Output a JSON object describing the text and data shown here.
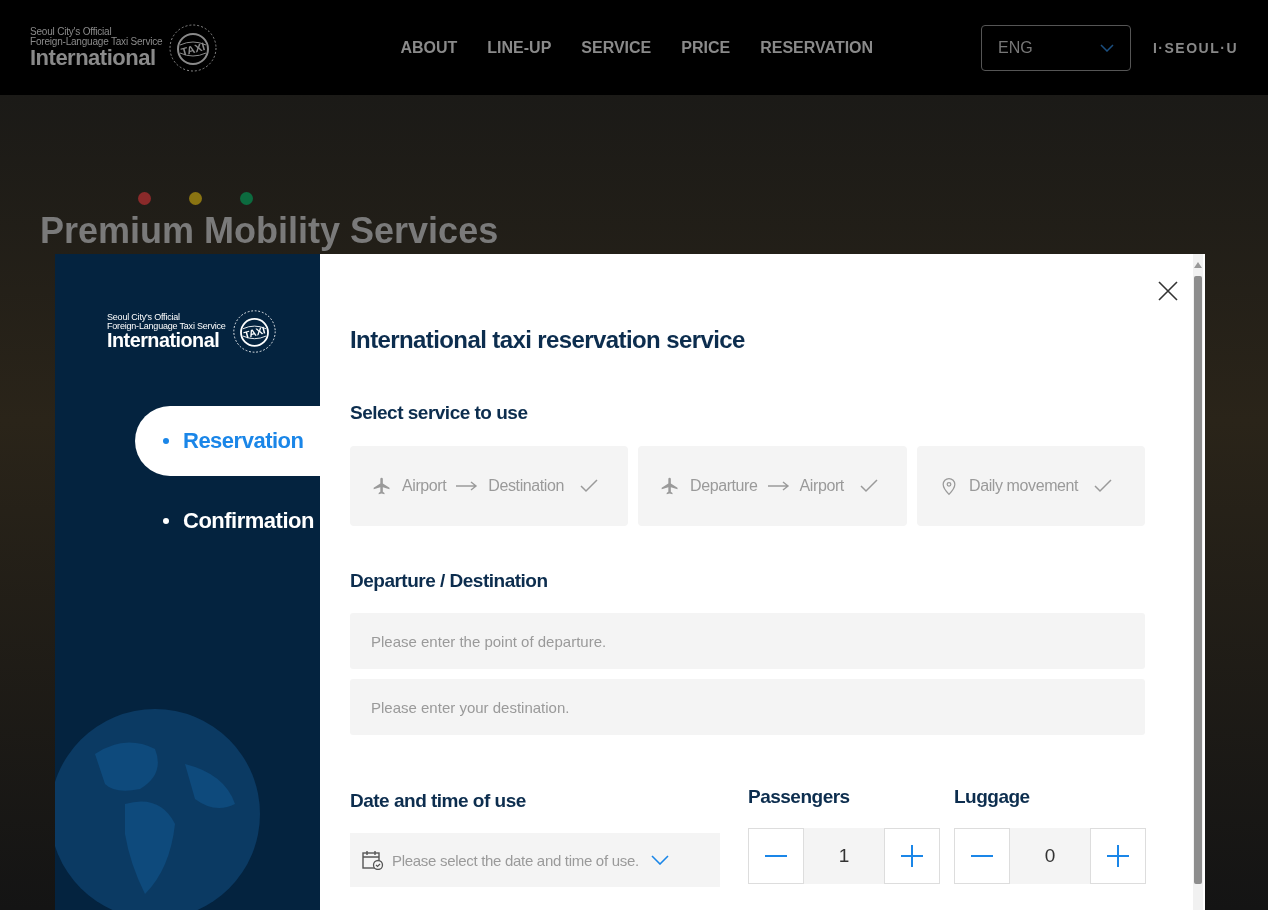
{
  "header": {
    "logo": {
      "line_1": "Seoul City's Official",
      "line_2": "Foreign-Language Taxi Service",
      "name": "International",
      "badge": "TAXI"
    },
    "nav": [
      "ABOUT",
      "LINE-UP",
      "SERVICE",
      "PRICE",
      "RESERVATION"
    ],
    "language": {
      "value": "ENG"
    },
    "brand": "I·SEOUL·U"
  },
  "hero": {
    "dots": [
      {
        "color": "#8a2a2a"
      },
      {
        "color": "#8a7412"
      },
      {
        "color": "#0c6b3f"
      }
    ],
    "lines": [
      "Premium Mobility Services"
    ]
  },
  "modal": {
    "sidebar": {
      "logo": {
        "line_1": "Seoul City's Official",
        "line_2": "Foreign-Language Taxi Service",
        "name": "International",
        "badge": "TAXI"
      },
      "steps": [
        {
          "label": "Reservation",
          "selected": true
        },
        {
          "label": "Confirmation",
          "selected": false
        }
      ]
    },
    "title": "International taxi reservation service",
    "service_heading": "Select service to use",
    "services": [
      {
        "kind": "plane",
        "from": "Airport",
        "to": "Destination",
        "selected": false
      },
      {
        "kind": "plane",
        "from": "Departure",
        "to": "Airport",
        "selected": false
      },
      {
        "kind": "pin",
        "label": "Daily movement",
        "selected": false
      }
    ],
    "route_heading": "Departure / Destination",
    "route_fields": [
      {
        "placeholder": "Please enter the point of departure."
      },
      {
        "placeholder": "Please enter your destination."
      }
    ],
    "date": {
      "heading": "Date and time of use",
      "placeholder": "Please select the date and time of use."
    },
    "counters": [
      {
        "label": "Passengers",
        "value": "1"
      },
      {
        "label": "Luggage",
        "value": "0"
      }
    ]
  }
}
